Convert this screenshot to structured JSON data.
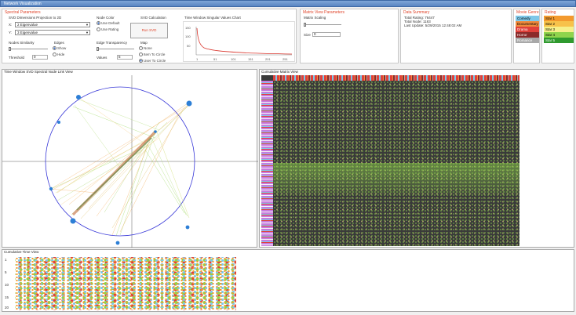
{
  "app": {
    "title": "Network Visualization"
  },
  "spectral": {
    "title": "Spectral Parameters",
    "projection_label": "SVD Dimensions Projection to 2D",
    "x_label": "X:",
    "x_value": "2 Eigenvalue",
    "y_label": "Y:",
    "y_value": "3 Eigenvalue",
    "node_similarity": "Nodes Similarity",
    "threshold_label": "Threshold",
    "threshold_value": "0",
    "edges_label": "Edges",
    "edges_show": "Show",
    "edges_hide": "Hide",
    "node_color": "Node Color",
    "use_default": "Use Default",
    "use_rating": "Use Rating",
    "edge_transparency": "Edge Transparency",
    "values_label": "Values",
    "values_value": "5",
    "svd_calc": "SVD Calculation",
    "run_svd": "Run SVD",
    "map_label": "Map",
    "map_none": "None",
    "map_item": "Item To Circle",
    "map_user": "User To Circle",
    "chart_title": "Time Window Singular Values Chart",
    "chart_yticks": [
      "150",
      "100",
      "50"
    ],
    "chart_xticks": [
      "1",
      "51",
      "101",
      "151",
      "201",
      "251"
    ]
  },
  "matrix": {
    "title": "Matrix View Parameters",
    "scaling_label": "Matrix Scaling",
    "size_label": "Size",
    "size_value": "0"
  },
  "summary": {
    "title": "Data Summary",
    "total_rating": "Total Rating: 76447",
    "total_node": "Total Node: 1183",
    "last_update": "Last Update: 5/29/2015 12:48:02 AM"
  },
  "movie_genre": {
    "title": "Movie Genre",
    "items": [
      {
        "label": "Comedy",
        "color": "#7ec7e8"
      },
      {
        "label": "Documentary",
        "color": "#f08a3c"
      },
      {
        "label": "Drama",
        "color": "#e0403a"
      },
      {
        "label": "Horror",
        "color": "#8b2a2a"
      },
      {
        "label": "Romance",
        "color": "#a8a8a8"
      }
    ]
  },
  "rating": {
    "title": "Rating",
    "items": [
      {
        "label": "Star 1",
        "color": "#f39a2e"
      },
      {
        "label": "Star 2",
        "color": "#f7c24a"
      },
      {
        "label": "Star 3",
        "color": "#f6f08a"
      },
      {
        "label": "Star 4",
        "color": "#8fd44c"
      },
      {
        "label": "Star 5",
        "color": "#2f9a2e"
      }
    ]
  },
  "panels": {
    "spectral_view": "Time Window SVD Spectral Node Link View",
    "cumulative_matrix": "Cumulative Matrix View",
    "cumulative_time": "Cumulative Time View",
    "time_yticks": [
      "1",
      "5",
      "10",
      "15",
      "20"
    ]
  }
}
